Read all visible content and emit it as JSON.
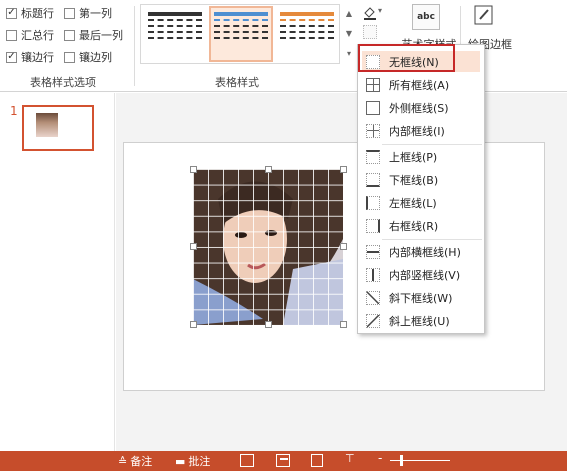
{
  "ribbon": {
    "options": [
      {
        "label": "标题行",
        "checked": true
      },
      {
        "label": "第一列",
        "checked": false
      },
      {
        "label": "汇总行",
        "checked": false
      },
      {
        "label": "最后一列",
        "checked": false
      },
      {
        "label": "镶边行",
        "checked": true
      },
      {
        "label": "镶边列",
        "checked": false
      }
    ],
    "options_group_label": "表格样式选项",
    "styles_group_label": "表格样式",
    "wordart_label": "艺术字样式",
    "draw_border_label": "绘图边框",
    "wordart_icon_text": "abc",
    "colors": {
      "dark": "#333333",
      "blue": "#4e8fd1",
      "orange": "#e58a3c"
    }
  },
  "slides": {
    "number": "1"
  },
  "border_menu": {
    "items": [
      {
        "label": "无框线(N)"
      },
      {
        "label": "所有框线(A)"
      },
      {
        "label": "外侧框线(S)"
      },
      {
        "label": "内部框线(I)"
      },
      {
        "label": "上框线(P)"
      },
      {
        "label": "下框线(B)"
      },
      {
        "label": "左框线(L)"
      },
      {
        "label": "右框线(R)"
      },
      {
        "label": "内部横框线(H)"
      },
      {
        "label": "内部竖框线(V)"
      },
      {
        "label": "斜下框线(W)"
      },
      {
        "label": "斜上框线(U)"
      }
    ],
    "highlighted": "无框线(N)",
    "highlight_color": "#c62828"
  },
  "statusbar": {
    "notes_label": "备注",
    "comments_label": "批注",
    "color": "#c64d2b"
  }
}
